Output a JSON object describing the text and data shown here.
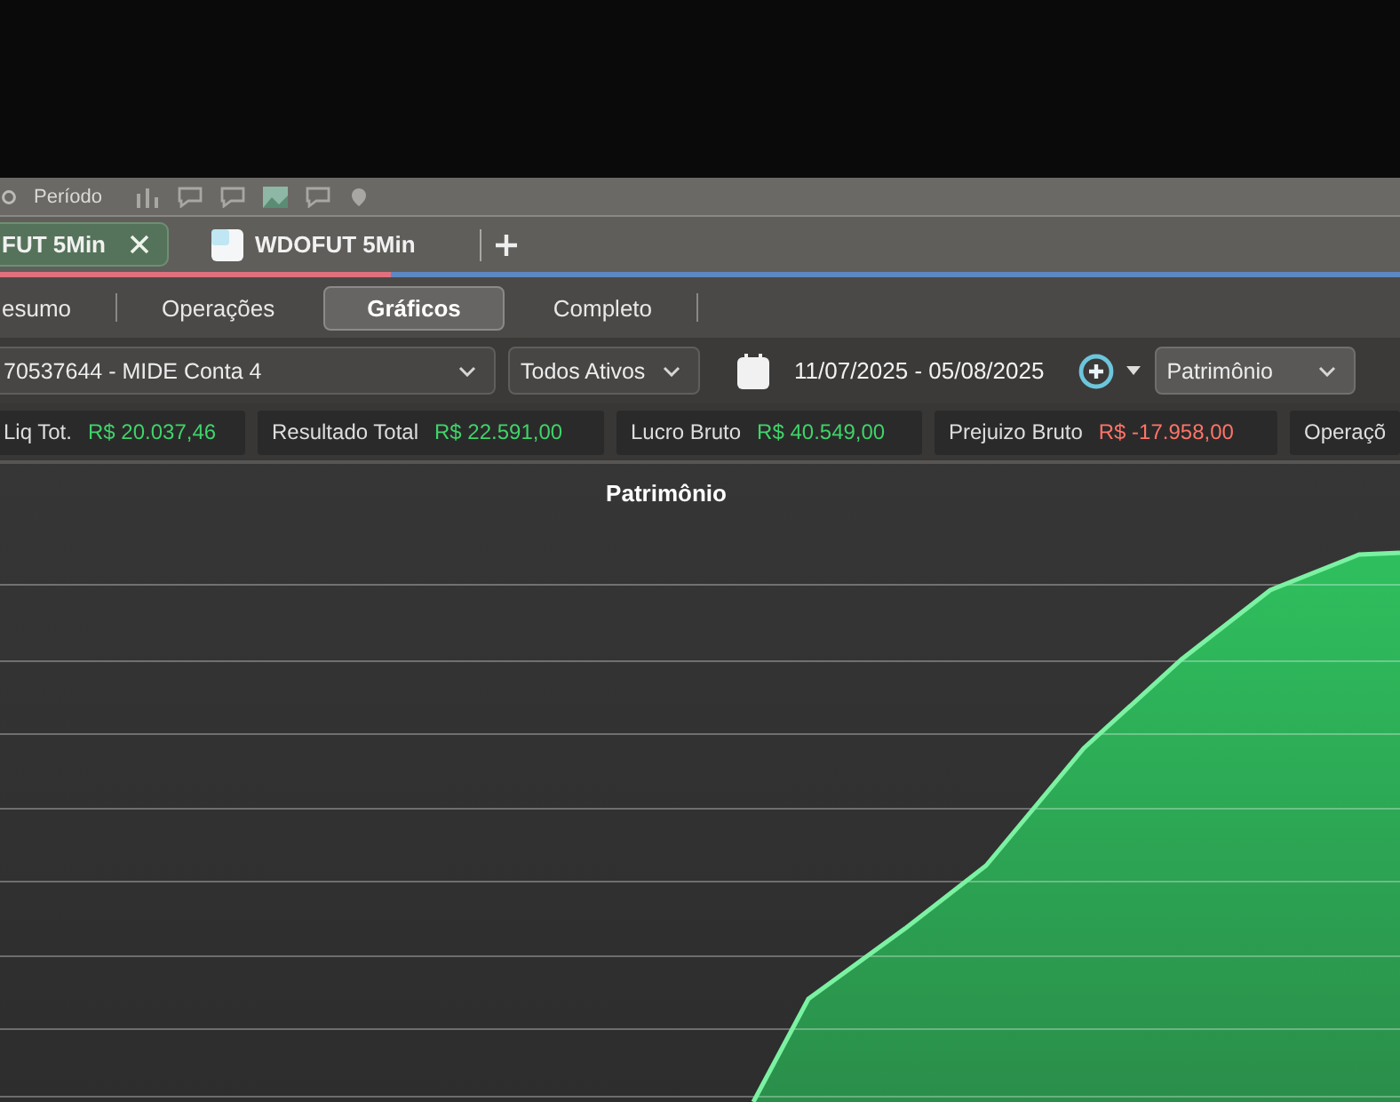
{
  "toolbar": {
    "label": "Período"
  },
  "tabs": [
    {
      "label": "FUT 5Min",
      "selected": true,
      "icon": false,
      "closable": true
    },
    {
      "label": "WDOFUT 5Min",
      "selected": false,
      "icon": true,
      "closable": false
    }
  ],
  "views": [
    {
      "label": "esumo",
      "selected": false
    },
    {
      "label": "Operações",
      "selected": false
    },
    {
      "label": "Gráficos",
      "selected": true
    },
    {
      "label": "Completo",
      "selected": false
    }
  ],
  "filters": {
    "account": "70537644 - MIDE Conta 4",
    "assets": "Todos Ativos",
    "date_range": "11/07/2025 - 05/08/2025",
    "metric": "Patrimônio"
  },
  "stats": [
    {
      "label": "Liq Tot.",
      "value": "R$ 20.037,46",
      "color": "#3fd46a"
    },
    {
      "label": "Resultado Total",
      "value": "R$ 22.591,00",
      "color": "#3fd46a"
    },
    {
      "label": "Lucro Bruto",
      "value": "R$ 40.549,00",
      "color": "#3fd46a"
    },
    {
      "label": "Prejuizo Bruto",
      "value": "R$ -17.958,00",
      "color": "#ff7468"
    },
    {
      "label": "Operaçõ"
    }
  ],
  "chart": {
    "title": "Patrimônio"
  }
}
